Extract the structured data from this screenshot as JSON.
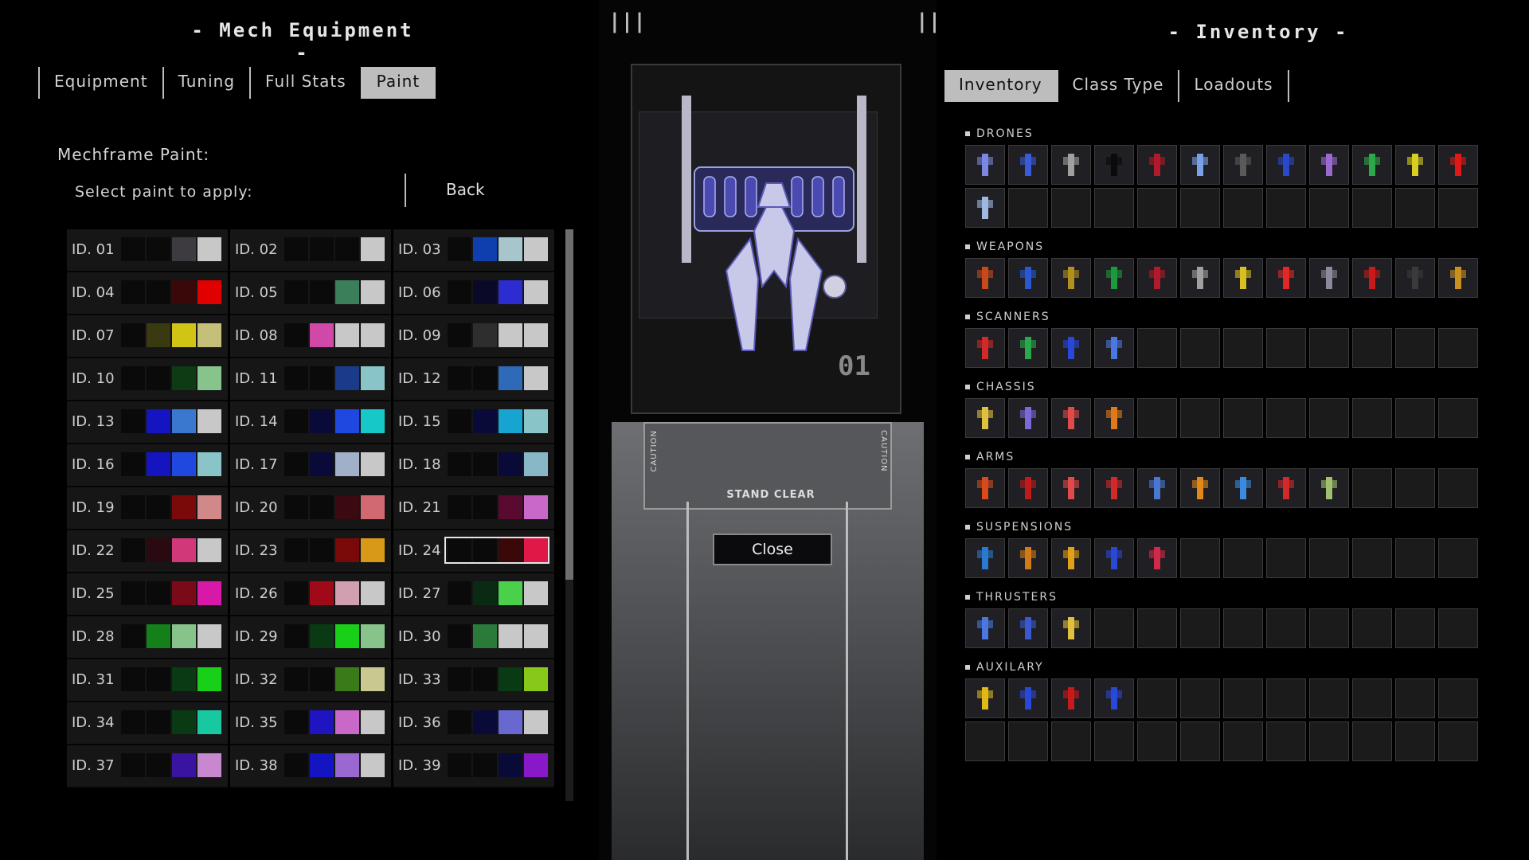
{
  "left_panel": {
    "title": "- Mech Equipment -",
    "tabs": [
      {
        "label": "Equipment",
        "active": false
      },
      {
        "label": "Tuning",
        "active": false
      },
      {
        "label": "Full Stats",
        "active": false
      },
      {
        "label": "Paint",
        "active": true
      }
    ],
    "mechframe_label": "Mechframe Paint:",
    "select_label": "Select paint to apply:",
    "back_label": "Back",
    "selected_paint": "ID. 24",
    "paints": [
      {
        "id": "ID. 01",
        "colors": [
          "#0a0a0a",
          "#0a0a0a",
          "#3d3a40",
          "#c8c8c8"
        ]
      },
      {
        "id": "ID. 02",
        "colors": [
          "#0a0a0a",
          "#0a0a0a",
          "#0a0a0a",
          "#c8c8c8"
        ]
      },
      {
        "id": "ID. 03",
        "colors": [
          "#0a0a0a",
          "#0f3fae",
          "#a7c6cc",
          "#c8c8c8"
        ]
      },
      {
        "id": "ID. 04",
        "colors": [
          "#0a0a0a",
          "#0a0a0a",
          "#3a0808",
          "#e00000"
        ]
      },
      {
        "id": "ID. 05",
        "colors": [
          "#0a0a0a",
          "#0a0a0a",
          "#3b7f5a",
          "#c8c8c8"
        ]
      },
      {
        "id": "ID. 06",
        "colors": [
          "#0a0a0a",
          "#0a0a28",
          "#2c2cd0",
          "#c8c8c8"
        ]
      },
      {
        "id": "ID. 07",
        "colors": [
          "#0a0a0a",
          "#3a3a10",
          "#d0c414",
          "#c4c07a"
        ]
      },
      {
        "id": "ID. 08",
        "colors": [
          "#0a0a0a",
          "#d048a8",
          "#c8c8c8",
          "#c8c8c8"
        ]
      },
      {
        "id": "ID. 09",
        "colors": [
          "#0a0a0a",
          "#2e2e2e",
          "#c8c8c8",
          "#c8c8c8"
        ]
      },
      {
        "id": "ID. 10",
        "colors": [
          "#0a0a0a",
          "#0a0a0a",
          "#0e3a14",
          "#86c48c"
        ]
      },
      {
        "id": "ID. 11",
        "colors": [
          "#0a0a0a",
          "#0a0a0a",
          "#1a3a8a",
          "#88c4c8"
        ]
      },
      {
        "id": "ID. 12",
        "colors": [
          "#0a0a0a",
          "#0a0a0a",
          "#2e6ab8",
          "#c8c8c8"
        ]
      },
      {
        "id": "ID. 13",
        "colors": [
          "#0a0a0a",
          "#1414c0",
          "#3a78d0",
          "#c8c8c8"
        ]
      },
      {
        "id": "ID. 14",
        "colors": [
          "#0a0a0a",
          "#0a0a38",
          "#1e48e0",
          "#16c8c8"
        ]
      },
      {
        "id": "ID. 15",
        "colors": [
          "#0a0a0a",
          "#0a0a38",
          "#18a4d0",
          "#88c4c8"
        ]
      },
      {
        "id": "ID. 16",
        "colors": [
          "#0a0a0a",
          "#1414c0",
          "#1e48e0",
          "#88c4c8"
        ]
      },
      {
        "id": "ID. 17",
        "colors": [
          "#0a0a0a",
          "#0a0a38",
          "#a0b0c8",
          "#c8c8c8"
        ]
      },
      {
        "id": "ID. 18",
        "colors": [
          "#0a0a0a",
          "#0a0a0a",
          "#0a0a38",
          "#88b8c8"
        ]
      },
      {
        "id": "ID. 19",
        "colors": [
          "#0a0a0a",
          "#0a0a0a",
          "#7a0a0a",
          "#d08888"
        ]
      },
      {
        "id": "ID. 20",
        "colors": [
          "#0a0a0a",
          "#0a0a0a",
          "#3a0a10",
          "#d06a70"
        ]
      },
      {
        "id": "ID. 21",
        "colors": [
          "#0a0a0a",
          "#0a0a0a",
          "#5a0a30",
          "#c868c8"
        ]
      },
      {
        "id": "ID. 22",
        "colors": [
          "#0a0a0a",
          "#2a0a10",
          "#d0387a",
          "#c8c8c8"
        ]
      },
      {
        "id": "ID. 23",
        "colors": [
          "#0a0a0a",
          "#0a0a0a",
          "#7a0a0a",
          "#d89818"
        ]
      },
      {
        "id": "ID. 24",
        "colors": [
          "#0a0a0a",
          "#0a0a0a",
          "#3a0808",
          "#e01848"
        ]
      },
      {
        "id": "ID. 25",
        "colors": [
          "#0a0a0a",
          "#0a0a0a",
          "#7a0a18",
          "#d818a8"
        ]
      },
      {
        "id": "ID. 26",
        "colors": [
          "#0a0a0a",
          "#a00a18",
          "#d0a0b0",
          "#c8c8c8"
        ]
      },
      {
        "id": "ID. 27",
        "colors": [
          "#0a0a0a",
          "#0a2a14",
          "#4ad04a",
          "#c8c8c8"
        ]
      },
      {
        "id": "ID. 28",
        "colors": [
          "#0a0a0a",
          "#14801a",
          "#86c48c",
          "#c8c8c8"
        ]
      },
      {
        "id": "ID. 29",
        "colors": [
          "#0a0a0a",
          "#0a3a14",
          "#18d018",
          "#86c48c"
        ]
      },
      {
        "id": "ID. 30",
        "colors": [
          "#0a0a0a",
          "#2a7a3a",
          "#c8c8c8",
          "#c8c8c8"
        ]
      },
      {
        "id": "ID. 31",
        "colors": [
          "#0a0a0a",
          "#0a0a0a",
          "#0a3a14",
          "#18d018"
        ]
      },
      {
        "id": "ID. 32",
        "colors": [
          "#0a0a0a",
          "#0a0a0a",
          "#3a7a18",
          "#c8c890"
        ]
      },
      {
        "id": "ID. 33",
        "colors": [
          "#0a0a0a",
          "#0a0a0a",
          "#0a3a14",
          "#88c818"
        ]
      },
      {
        "id": "ID. 34",
        "colors": [
          "#0a0a0a",
          "#0a0a0a",
          "#0a3a14",
          "#18c8a0"
        ]
      },
      {
        "id": "ID. 35",
        "colors": [
          "#0a0a0a",
          "#1e14c0",
          "#c868c8",
          "#c8c8c8"
        ]
      },
      {
        "id": "ID. 36",
        "colors": [
          "#0a0a0a",
          "#0a0a38",
          "#6868d0",
          "#c8c8c8"
        ]
      },
      {
        "id": "ID. 37",
        "colors": [
          "#0a0a0a",
          "#0a0a0a",
          "#3a14a0",
          "#c888d0"
        ]
      },
      {
        "id": "ID. 38",
        "colors": [
          "#0a0a0a",
          "#1414c0",
          "#9a68d0",
          "#c8c8c8"
        ]
      },
      {
        "id": "ID. 39",
        "colors": [
          "#0a0a0a",
          "#0a0a0a",
          "#0a0a38",
          "#8818c8"
        ]
      }
    ]
  },
  "center": {
    "bay_number": "01",
    "stand_clear": "STAND CLEAR",
    "caution_text": "CAUTION",
    "close_label": "Close"
  },
  "right_panel": {
    "title": "- Inventory -",
    "tabs": [
      {
        "label": "Inventory",
        "active": true
      },
      {
        "label": "Class Type",
        "active": false
      },
      {
        "label": "Loadouts",
        "active": false
      }
    ],
    "categories": [
      {
        "name": "DRONES",
        "rows": 2,
        "items": [
          {
            "icon": "drone-icon",
            "color": "#7a88e0"
          },
          {
            "icon": "drone-icon",
            "color": "#3a5ad8"
          },
          {
            "icon": "drone-icon",
            "color": "#a0a0a0"
          },
          {
            "icon": "drone-icon",
            "color": "#0a0a0a"
          },
          {
            "icon": "drone-icon",
            "color": "#b01a2a"
          },
          {
            "icon": "drone-icon",
            "color": "#7aa0e8"
          },
          {
            "icon": "drone-icon",
            "color": "#5a5a5a"
          },
          {
            "icon": "drone-icon",
            "color": "#2a48c8"
          },
          {
            "icon": "drone-icon",
            "color": "#9a6ad0"
          },
          {
            "icon": "drone-icon",
            "color": "#2aa84a"
          },
          {
            "icon": "drone-icon",
            "color": "#d8d020"
          },
          {
            "icon": "drone-icon",
            "color": "#e01818"
          },
          {
            "icon": "drone-icon",
            "color": "#a0b8e0"
          }
        ]
      },
      {
        "name": "WEAPONS",
        "rows": 1,
        "items": [
          {
            "icon": "weapon-icon",
            "color": "#c84a1a"
          },
          {
            "icon": "weapon-icon",
            "color": "#2a58d0"
          },
          {
            "icon": "weapon-icon",
            "color": "#b09020"
          },
          {
            "icon": "weapon-icon",
            "color": "#1a9a3a"
          },
          {
            "icon": "weapon-icon",
            "color": "#b01a2a"
          },
          {
            "icon": "weapon-icon",
            "color": "#a0a0a0"
          },
          {
            "icon": "weapon-icon",
            "color": "#d8c020"
          },
          {
            "icon": "weapon-icon",
            "color": "#e02828"
          },
          {
            "icon": "weapon-icon",
            "color": "#8a8a9a"
          },
          {
            "icon": "weapon-icon",
            "color": "#c81a1a"
          },
          {
            "icon": "weapon-icon",
            "color": "#3a3a3a"
          },
          {
            "icon": "weapon-icon",
            "color": "#c89020"
          }
        ]
      },
      {
        "name": "SCANNERS",
        "rows": 1,
        "items": [
          {
            "icon": "scanner-icon",
            "color": "#d02a2a"
          },
          {
            "icon": "scanner-icon",
            "color": "#2aa84a"
          },
          {
            "icon": "scanner-icon",
            "color": "#2a48d8"
          },
          {
            "icon": "scanner-icon",
            "color": "#4a78e0"
          }
        ]
      },
      {
        "name": "CHASSIS",
        "rows": 1,
        "items": [
          {
            "icon": "chassis-icon",
            "color": "#e0c040"
          },
          {
            "icon": "chassis-icon",
            "color": "#7a6ad8"
          },
          {
            "icon": "chassis-icon",
            "color": "#e04a4a"
          },
          {
            "icon": "chassis-icon",
            "color": "#e07a18"
          }
        ]
      },
      {
        "name": "ARMS",
        "rows": 1,
        "items": [
          {
            "icon": "arm-icon",
            "color": "#d84a1a"
          },
          {
            "icon": "arm-icon",
            "color": "#c01a1a"
          },
          {
            "icon": "arm-icon",
            "color": "#e04a4a"
          },
          {
            "icon": "arm-icon",
            "color": "#d02a2a"
          },
          {
            "icon": "arm-icon",
            "color": "#4a78d0"
          },
          {
            "icon": "arm-icon",
            "color": "#e08818"
          },
          {
            "icon": "arm-icon",
            "color": "#3a8ae0"
          },
          {
            "icon": "arm-icon",
            "color": "#d02a2a"
          },
          {
            "icon": "arm-icon",
            "color": "#a0c070"
          }
        ]
      },
      {
        "name": "SUSPENSIONS",
        "rows": 1,
        "items": [
          {
            "icon": "suspension-icon",
            "color": "#2a78d0"
          },
          {
            "icon": "suspension-icon",
            "color": "#d07a18"
          },
          {
            "icon": "suspension-icon",
            "color": "#e0a018"
          },
          {
            "icon": "suspension-icon",
            "color": "#2a48d8"
          },
          {
            "icon": "suspension-icon",
            "color": "#d02a48"
          }
        ]
      },
      {
        "name": "THRUSTERS",
        "rows": 1,
        "items": [
          {
            "icon": "thruster-icon",
            "color": "#4a78e0"
          },
          {
            "icon": "thruster-icon",
            "color": "#3a58d0"
          },
          {
            "icon": "thruster-icon",
            "color": "#e0c040"
          }
        ]
      },
      {
        "name": "AUXILARY",
        "rows": 2,
        "items": [
          {
            "icon": "shield-icon",
            "color": "#e0b818"
          },
          {
            "icon": "shield-icon",
            "color": "#2a48d8"
          },
          {
            "icon": "armor-plate-icon",
            "color": "#c81a1a"
          },
          {
            "icon": "module-icon",
            "color": "#2a48d8"
          }
        ]
      }
    ]
  }
}
